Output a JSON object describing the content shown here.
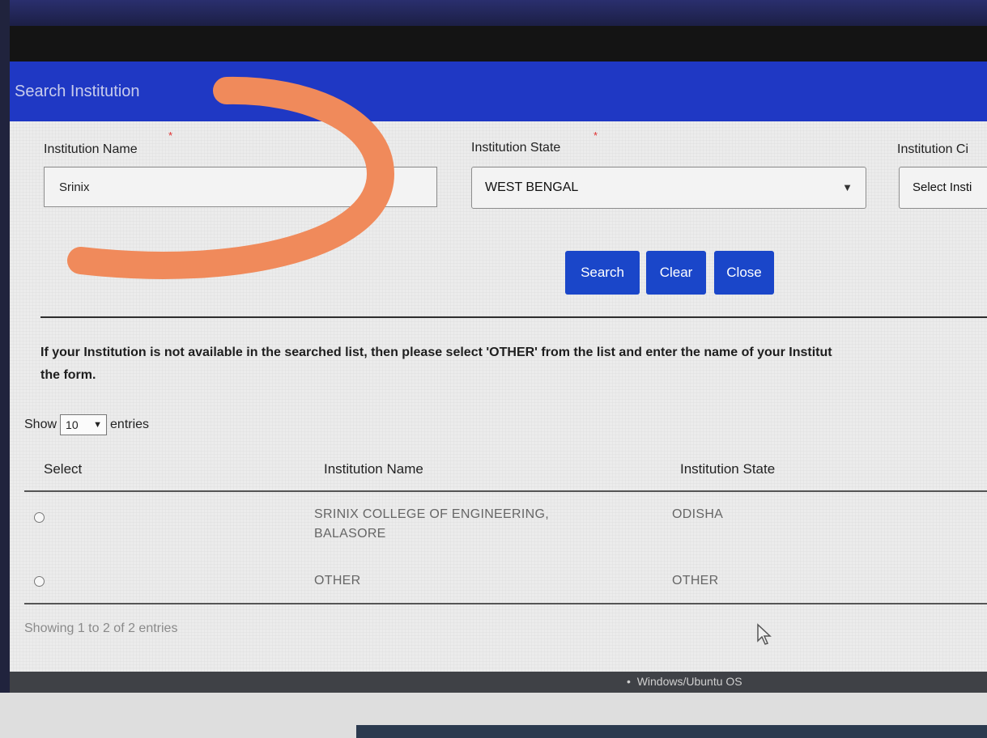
{
  "dialog": {
    "title": "Search Institution"
  },
  "form": {
    "name_label": "Institution Name",
    "name_value": "Srinix",
    "state_label": "Institution State",
    "state_value": "WEST BENGAL",
    "city_label": "Institution Ci",
    "city_value": "Select Insti",
    "required_mark": "*"
  },
  "buttons": {
    "search": "Search",
    "clear": "Clear",
    "close": "Close"
  },
  "info": {
    "line1": "If your Institution is not available in the searched list, then please select 'OTHER' from the list and enter the name of your Institut",
    "line2": "the form."
  },
  "length": {
    "show": "Show",
    "value": "10",
    "entries": "entries"
  },
  "table": {
    "headers": [
      "Select",
      "Institution Name",
      "Institution State"
    ],
    "rows": [
      {
        "name_line1": "SRINIX COLLEGE OF ENGINEERING,",
        "name_line2": "BALASORE",
        "state": "ODISHA"
      },
      {
        "name_line1": "OTHER",
        "name_line2": "",
        "state": "OTHER"
      }
    ]
  },
  "footer": {
    "info": "Showing 1 to 2 of 2 entries"
  },
  "background": {
    "bullet_text": "Windows/Ubuntu OS"
  },
  "colors": {
    "header": "#1f38c4",
    "button": "#1a46c9",
    "annotation": "#f08a5b"
  },
  "icons": {
    "dropdown": "triangle-down-icon",
    "length_dropdown": "chevron-down-icon",
    "cursor": "mouse-pointer-icon"
  }
}
